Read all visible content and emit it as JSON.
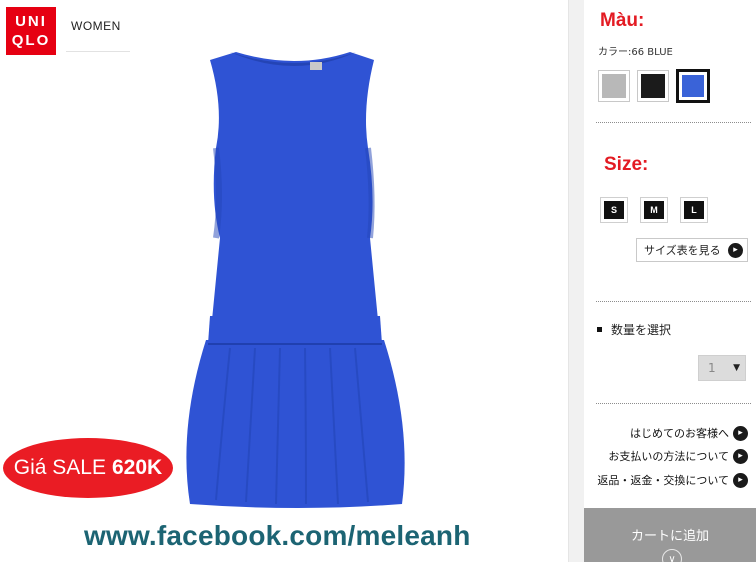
{
  "header": {
    "logo_line1": "UNI",
    "logo_line2": "QLO",
    "nav_label": "WOMEN"
  },
  "promo": {
    "sale_prefix": "Giá SALE",
    "sale_price": "620K",
    "facebook_url": "www.facebook.com/meleanh",
    "badge_color": "#ea1c24"
  },
  "product": {
    "color": "#2f53d4"
  },
  "color_section": {
    "title": "Màu:",
    "selected_label": "カラー:66 BLUE",
    "swatches": [
      {
        "name": "gray",
        "hex": "#b8b8b8",
        "selected": false
      },
      {
        "name": "black",
        "hex": "#1b1b1b",
        "selected": false
      },
      {
        "name": "blue",
        "hex": "#3a63d8",
        "selected": true
      }
    ]
  },
  "size_section": {
    "title": "Size:",
    "sizes": [
      "S",
      "M",
      "L"
    ],
    "size_chart_label": "サイズ表を見る"
  },
  "quantity": {
    "label": "数量を選択",
    "value": "1"
  },
  "help_links": [
    "はじめてのお客様へ",
    "お支払いの方法について",
    "返品・返金・交換について"
  ],
  "cart": {
    "label": "カートに追加"
  }
}
